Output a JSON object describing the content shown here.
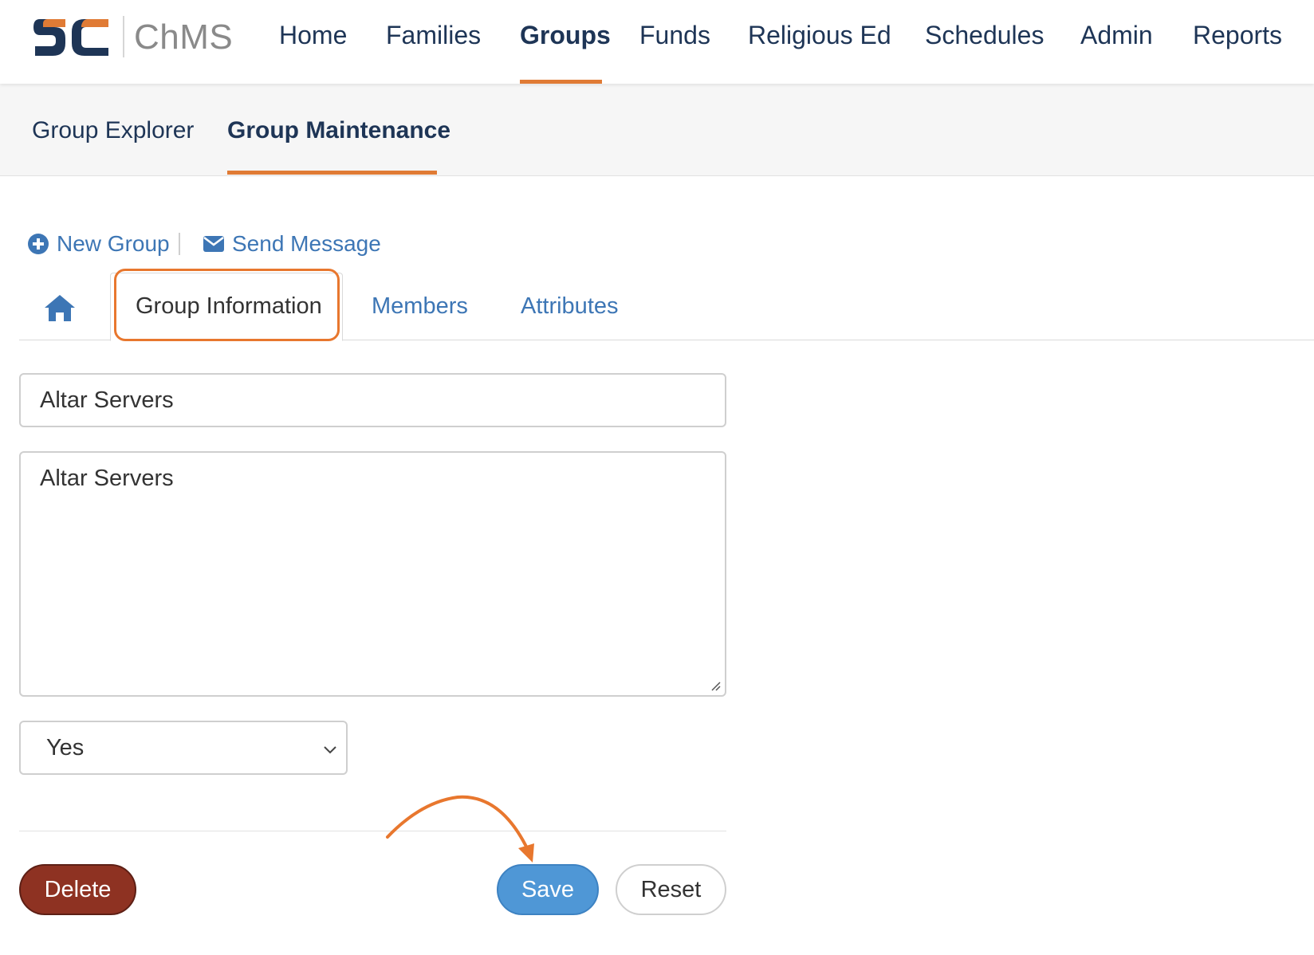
{
  "app": {
    "logo_text": "ChMS"
  },
  "nav": {
    "items": [
      {
        "label": "Home"
      },
      {
        "label": "Families"
      },
      {
        "label": "Groups"
      },
      {
        "label": "Funds"
      },
      {
        "label": "Religious Ed"
      },
      {
        "label": "Schedules"
      },
      {
        "label": "Admin"
      },
      {
        "label": "Reports"
      }
    ],
    "active": "Groups"
  },
  "subnav": {
    "items": [
      {
        "label": "Group Explorer"
      },
      {
        "label": "Group Maintenance"
      }
    ],
    "active": "Group Maintenance"
  },
  "actions": {
    "new_group": "New Group",
    "send_message": "Send Message"
  },
  "tabs": {
    "items": [
      {
        "label": "Group Information"
      },
      {
        "label": "Members"
      },
      {
        "label": "Attributes"
      }
    ],
    "active": "Group Information"
  },
  "form": {
    "name_value": "Altar Servers",
    "description_value": "Altar Servers",
    "active_select_value": "Yes"
  },
  "buttons": {
    "delete": "Delete",
    "save": "Save",
    "reset": "Reset"
  },
  "colors": {
    "accent_orange": "#e07b35",
    "link_blue": "#3d76b5",
    "nav_navy": "#1e3556",
    "save_blue": "#4f97d6",
    "delete_red": "#8e3222"
  }
}
